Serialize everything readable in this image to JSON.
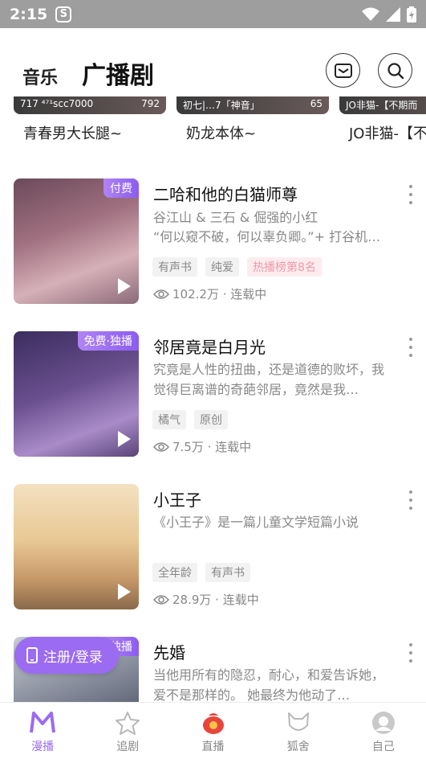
{
  "status_bar": {
    "time": "2:15",
    "app_icon": "s-icon"
  },
  "header": {
    "tab_music": "音乐",
    "tab_radio_drama": "广播剧",
    "mail_icon": "mail-icon",
    "search_icon": "search-icon"
  },
  "top_strip": [
    {
      "thumb_left": "717 ⁴⁷¹scc7000",
      "thumb_right": "792",
      "title": "青春男大长腿~"
    },
    {
      "thumb_left": "初七|…7「神音」",
      "thumb_right": "65",
      "title": "奶龙本体~"
    },
    {
      "thumb_left": "JO非猫-【不期而",
      "thumb_right": "",
      "title": "JO非猫-【不"
    }
  ],
  "items": [
    {
      "badge": "付费",
      "title": "二哈和他的白猫师尊",
      "authors": "谷江山 & 三石 & 倔强的小红",
      "desc": "“何以窥不破，何以辜负卿。”+ 打谷机…",
      "chips": [
        "有声书",
        "纯爱",
        "热播榜第8名"
      ],
      "stats": "102.2万 · 连载中"
    },
    {
      "badge": "免费·独播",
      "title": "邻居竟是白月光",
      "desc": "究竟是人性的扭曲，还是道德的败坏，我觉得巨离谱的奇葩邻居，竟然是我…",
      "chips": [
        "橘气",
        "原创"
      ],
      "stats": "7.5万 · 连载中"
    },
    {
      "badge": "",
      "title": "小王子",
      "desc": "《小王子》是一篇儿童文学短篇小说",
      "chips": [
        "全年龄",
        "有声书"
      ],
      "stats": "28.9万 · 连载中"
    },
    {
      "badge": "独播",
      "title": "先婚",
      "desc": "当他用所有的隐忍，耐心，和爱告诉她，爱不是那样的。 她最终为他动了…"
    }
  ],
  "login_button": "注册/登录",
  "tabbar": [
    {
      "label": "漫播",
      "icon": "m-logo-icon",
      "active": true
    },
    {
      "label": "追剧",
      "icon": "star-icon",
      "active": false
    },
    {
      "label": "直播",
      "icon": "live-bag-icon",
      "active": false
    },
    {
      "label": "狐舍",
      "icon": "fox-icon",
      "active": false
    },
    {
      "label": "自己",
      "icon": "avatar-icon",
      "active": false
    }
  ],
  "colors": {
    "accent": "#9b6bf2",
    "status_bar": "#9e9e9e",
    "hot_chip": "#f09aa6"
  }
}
